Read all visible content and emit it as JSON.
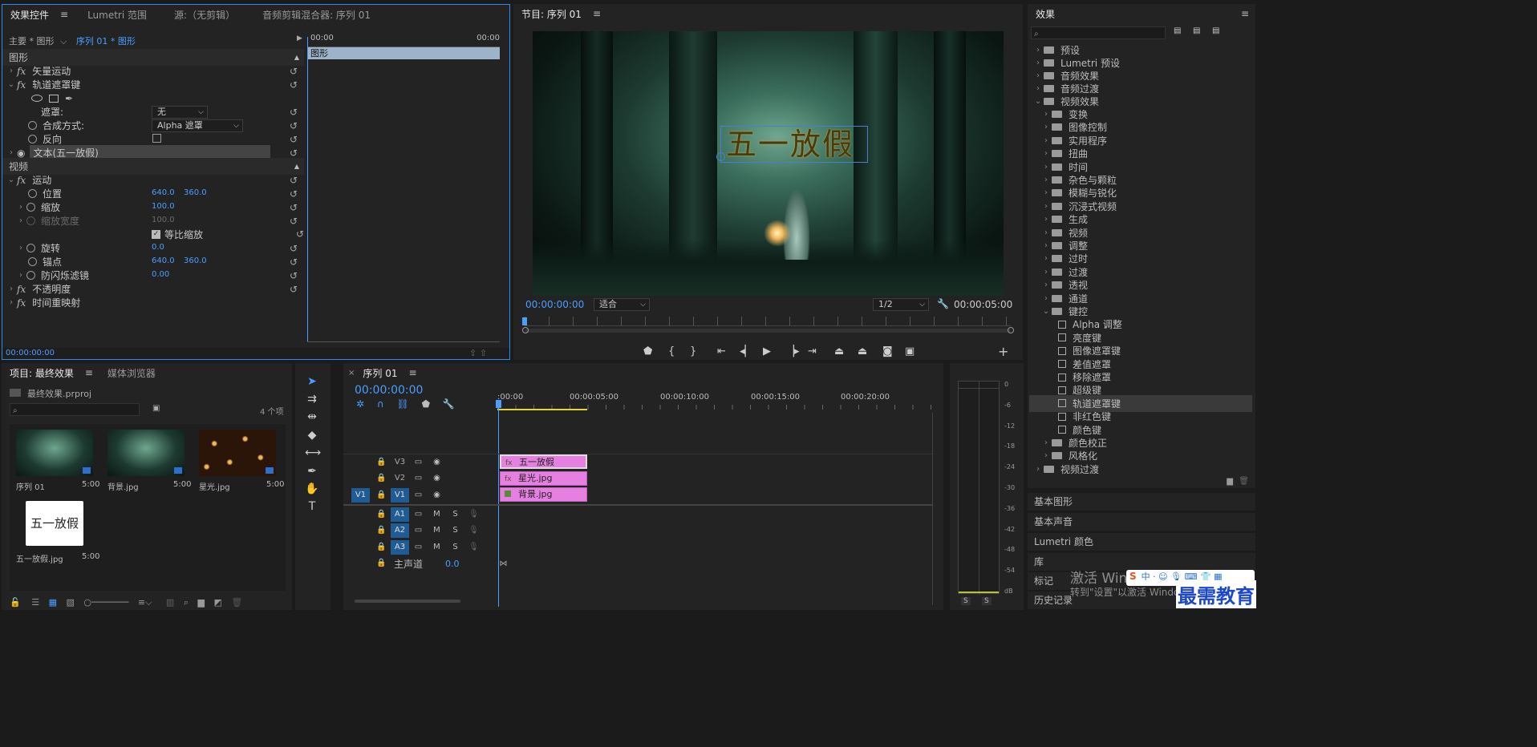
{
  "effect_controls": {
    "tabs": [
      "效果控件",
      "Lumetri 范围",
      "源:（无剪辑）",
      "音频剪辑混合器: 序列 01"
    ],
    "master": "主要 * 图形",
    "seq_link": "序列 01 * 图形",
    "time_start": "00:00",
    "time_end": "00:00",
    "clip_label": "图形",
    "section_graphic": "图形",
    "section_video": "视频",
    "vector_motion": "矢量运动",
    "track_matte": "轨道遮罩键",
    "matte_label": "遮罩:",
    "matte_value": "无",
    "composite_label": "合成方式:",
    "composite_value": "Alpha 遮罩",
    "reverse_label": "反向",
    "text_layer": "文本(五一放假)",
    "motion": "运动",
    "position_label": "位置",
    "pos_x": "640.0",
    "pos_y": "360.0",
    "scale_label": "缩放",
    "scale_value": "100.0",
    "scale_width_label": "缩放宽度",
    "scale_width_value": "100.0",
    "uniform_scale": "等比缩放",
    "rotation_label": "旋转",
    "rotation_value": "0.0",
    "anchor_label": "锚点",
    "anchor_x": "640.0",
    "anchor_y": "360.0",
    "flicker_label": "防闪烁滤镜",
    "flicker_value": "0.00",
    "opacity": "不透明度",
    "time_remap": "时间重映射",
    "timecode": "00:00:00:00"
  },
  "program": {
    "title": "节目: 序列 01",
    "overlay_text": "五一放假",
    "timecode": "00:00:00:00",
    "fit": "适合",
    "resolution": "1/2",
    "duration": "00:00:05:00"
  },
  "effects": {
    "title": "效果",
    "presets": "预设",
    "lumetri_presets": "Lumetri 预设",
    "audio_effects": "音频效果",
    "audio_transitions": "音频过渡",
    "video_effects": "视频效果",
    "video_folders": [
      "变换",
      "图像控制",
      "实用程序",
      "扭曲",
      "时间",
      "杂色与颗粒",
      "模糊与锐化",
      "沉浸式视频",
      "生成",
      "视频",
      "调整",
      "过时",
      "过渡",
      "透视",
      "通道"
    ],
    "keying": "键控",
    "keying_items": [
      "Alpha 调整",
      "亮度键",
      "图像遮罩键",
      "差值遮罩",
      "移除遮罩",
      "超级键",
      "轨道遮罩键",
      "非红色键",
      "颜色键"
    ],
    "color_correction": "颜色校正",
    "stylize": "风格化",
    "video_transitions": "视频过渡",
    "bottom_items": [
      "基本图形",
      "基本声音",
      "Lumetri 颜色",
      "库",
      "标记",
      "历史记录"
    ]
  },
  "project": {
    "tabs": [
      "项目: 最终效果",
      "媒体浏览器"
    ],
    "file": "最终效果.prproj",
    "count": "4 个项",
    "items": [
      {
        "name": "序列 01",
        "dur": "5:00"
      },
      {
        "name": "背景.jpg",
        "dur": "5:00"
      },
      {
        "name": "星光.jpg",
        "dur": "5:00"
      },
      {
        "name": "五一放假.jpg",
        "dur": "5:00"
      }
    ],
    "thumb_text": "五一放假"
  },
  "timeline": {
    "tab": "序列 01",
    "timecode": "00:00:00:00",
    "ruler": [
      ":00:00",
      "00:00:05:00",
      "00:00:10:00",
      "00:00:15:00",
      "00:00:20:00"
    ],
    "video_tracks": [
      "V3",
      "V2",
      "V1"
    ],
    "audio_tracks": [
      "A1",
      "A2",
      "A3"
    ],
    "source_patch": "V1",
    "clips": [
      "五一放假",
      "星光.jpg",
      "背景.jpg"
    ],
    "master_label": "主声道",
    "master_value": "0.0",
    "m": "M",
    "s": "S"
  },
  "meter": {
    "scale": [
      "0",
      "-6",
      "-12",
      "-18",
      "-24",
      "-30",
      "-36",
      "-42",
      "-48",
      "-54",
      "dB"
    ],
    "s1": "S",
    "s2": "S"
  },
  "watermark": {
    "activate": "激活 Windows",
    "hint": "转到\"设置\"以激活 Windows。",
    "brand": "最需教育"
  }
}
